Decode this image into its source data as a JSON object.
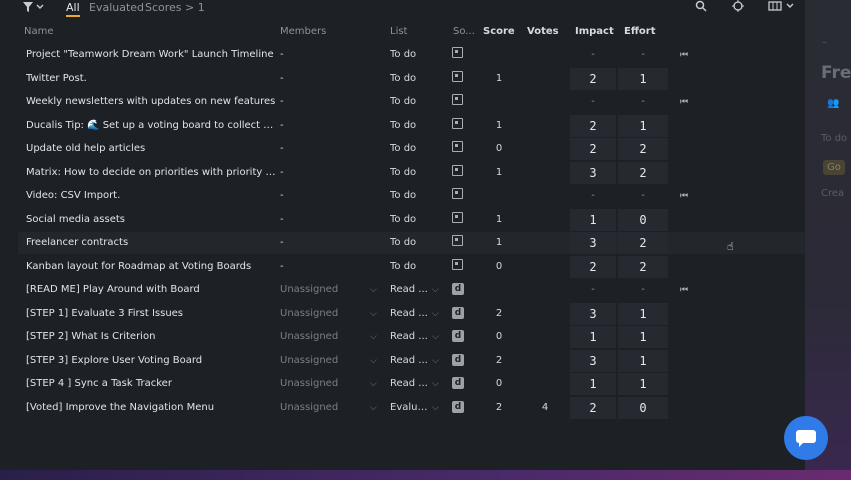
{
  "toolbar": {
    "tabs": [
      "All",
      "Evaluated",
      "Scores > 1"
    ],
    "active_tab": "All"
  },
  "columns": [
    "Name",
    "Members",
    "List",
    "So...",
    "Score",
    "Votes",
    "Impact",
    "Effort"
  ],
  "rows": [
    {
      "name": "Project \"Teamwork Dream Work\" Launch Timeline",
      "members": "-",
      "list": "To do",
      "source": "doc",
      "score": "",
      "votes": "",
      "impact": "-",
      "effort": "-",
      "excluded": true
    },
    {
      "name": "Twitter Post.",
      "members": "-",
      "list": "To do",
      "source": "doc",
      "score": "1",
      "votes": "",
      "impact": "2",
      "effort": "1",
      "excluded": false
    },
    {
      "name": "Weekly newsletters with updates on new features",
      "members": "-",
      "list": "To do",
      "source": "doc",
      "score": "",
      "votes": "",
      "impact": "-",
      "effort": "-",
      "excluded": true
    },
    {
      "name": "Ducalis Tip: 🌊 Set up a voting board to collect feed...",
      "members": "-",
      "list": "To do",
      "source": "doc",
      "score": "1",
      "votes": "",
      "impact": "2",
      "effort": "1",
      "excluded": false
    },
    {
      "name": "Update old help articles",
      "members": "-",
      "list": "To do",
      "source": "doc",
      "score": "0",
      "votes": "",
      "impact": "2",
      "effort": "2",
      "excluded": false
    },
    {
      "name": "Matrix: How to decide on priorities with priority matri...",
      "members": "-",
      "list": "To do",
      "source": "doc",
      "score": "1",
      "votes": "",
      "impact": "3",
      "effort": "2",
      "excluded": false
    },
    {
      "name": "Video: CSV Import.",
      "members": "-",
      "list": "To do",
      "source": "doc",
      "score": "",
      "votes": "",
      "impact": "-",
      "effort": "-",
      "excluded": true
    },
    {
      "name": "Social media assets",
      "members": "-",
      "list": "To do",
      "source": "doc",
      "score": "1",
      "votes": "",
      "impact": "1",
      "effort": "0",
      "excluded": false
    },
    {
      "name": "Freelancer contracts",
      "members": "-",
      "list": "To do",
      "source": "doc",
      "score": "1",
      "votes": "",
      "impact": "3",
      "effort": "2",
      "excluded": false
    },
    {
      "name": "Kanban layout for Roadmap at Voting Boards",
      "members": "-",
      "list": "To do",
      "source": "doc",
      "score": "0",
      "votes": "",
      "impact": "2",
      "effort": "2",
      "excluded": false
    },
    {
      "name": "[READ ME] Play Around with Board",
      "members": "Unassigned",
      "list": "Read ...",
      "source": "d",
      "score": "",
      "votes": "",
      "impact": "-",
      "effort": "-",
      "excluded": true
    },
    {
      "name": "[STEP 1] Evaluate 3 First Issues",
      "members": "Unassigned",
      "list": "Read ...",
      "source": "d",
      "score": "2",
      "votes": "",
      "impact": "3",
      "effort": "1",
      "excluded": false
    },
    {
      "name": "[STEP 2] What Is Criterion",
      "members": "Unassigned",
      "list": "Read ...",
      "source": "d",
      "score": "0",
      "votes": "",
      "impact": "1",
      "effort": "1",
      "excluded": false
    },
    {
      "name": "[STEP 3] Explore User Voting Board",
      "members": "Unassigned",
      "list": "Read ...",
      "source": "d",
      "score": "2",
      "votes": "",
      "impact": "3",
      "effort": "1",
      "excluded": false
    },
    {
      "name": "[STEP 4 ] Sync a Task Tracker",
      "members": "Unassigned",
      "list": "Read ...",
      "source": "d",
      "score": "0",
      "votes": "",
      "impact": "1",
      "effort": "1",
      "excluded": false
    },
    {
      "name": "[Voted] Improve the Navigation Menu",
      "members": "Unassigned",
      "list": "Evalua...",
      "source": "d",
      "score": "2",
      "votes": "4",
      "impact": "2",
      "effort": "0",
      "excluded": false
    }
  ],
  "ghost_panel": {
    "title": "Fre",
    "label1": "To do",
    "label2": "Go",
    "label3": "Crea"
  },
  "colors": {
    "accent": "#e7a930",
    "chat": "#2f7be8"
  }
}
